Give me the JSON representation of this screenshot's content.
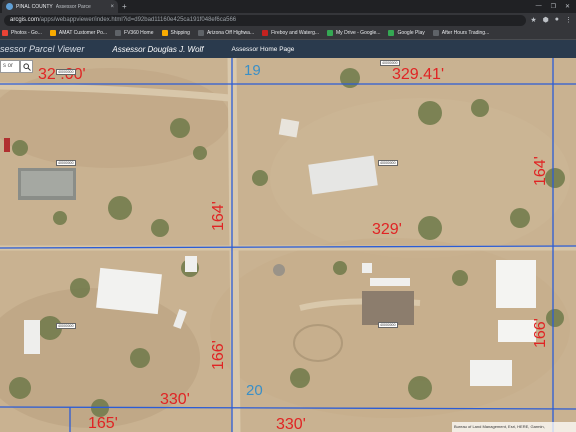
{
  "browser": {
    "tab": {
      "label_primary": "PINAL COUNTY",
      "label_secondary": "Assessor Parce",
      "close_glyph": "×"
    },
    "new_tab_glyph": "+",
    "window_controls": [
      "—",
      "❐",
      "✕"
    ],
    "url": {
      "host": "arcgis.com",
      "path": "/apps/webappviewer/index.html?id=d92bad11160e425ca191f048ef6ca566"
    },
    "bookmarks": [
      {
        "label": "Photos - Go...",
        "icon_color": "#ea4335"
      },
      {
        "label": "AMAT Customer Po...",
        "icon_color": "#f9ab00"
      },
      {
        "label": "FV360 Home",
        "icon_color": "#5f6368"
      },
      {
        "label": "Shipping",
        "icon_color": "#f9ab00"
      },
      {
        "label": "Arizona Off Highwa...",
        "icon_color": "#5f6368"
      },
      {
        "label": "Fireboy and Waterg...",
        "icon_color": "#c5221f"
      },
      {
        "label": "My Drive - Google...",
        "icon_color": "#34a853"
      },
      {
        "label": "Google Play",
        "icon_color": "#34a853"
      },
      {
        "label": "After Hours Trading...",
        "icon_color": "#5f6368"
      }
    ]
  },
  "app": {
    "title": "sessor Parcel Viewer",
    "assessor": "Assessor Douglas J. Wolf",
    "home_link": "Assessor Home Page",
    "search_placeholder": "s or"
  },
  "map": {
    "section_labels": [
      "19",
      "20"
    ],
    "dimensions": {
      "top_left": "32 .00'",
      "top_right": "329.41'",
      "middle": "329'",
      "bottom_left": "330'",
      "bottom_left_2": "165'",
      "bottom_mid": "330'"
    },
    "vertical_dimensions": {
      "center_upper": "164'",
      "right_upper": "164'",
      "center_lower": "166'",
      "right_lower": "166'"
    },
    "parcel_ids": [
      "40000000",
      "40000000",
      "40000000",
      "40000000",
      "40000000",
      "40000000"
    ],
    "attribution": "Bureau of Land Management, Esri, HERE, Garmin,"
  },
  "colors": {
    "parcel_line": "#2b5cd6",
    "dimension_text": "#e02424",
    "section_text": "#3a8fc7",
    "header_bg": "#2a3a4d"
  }
}
